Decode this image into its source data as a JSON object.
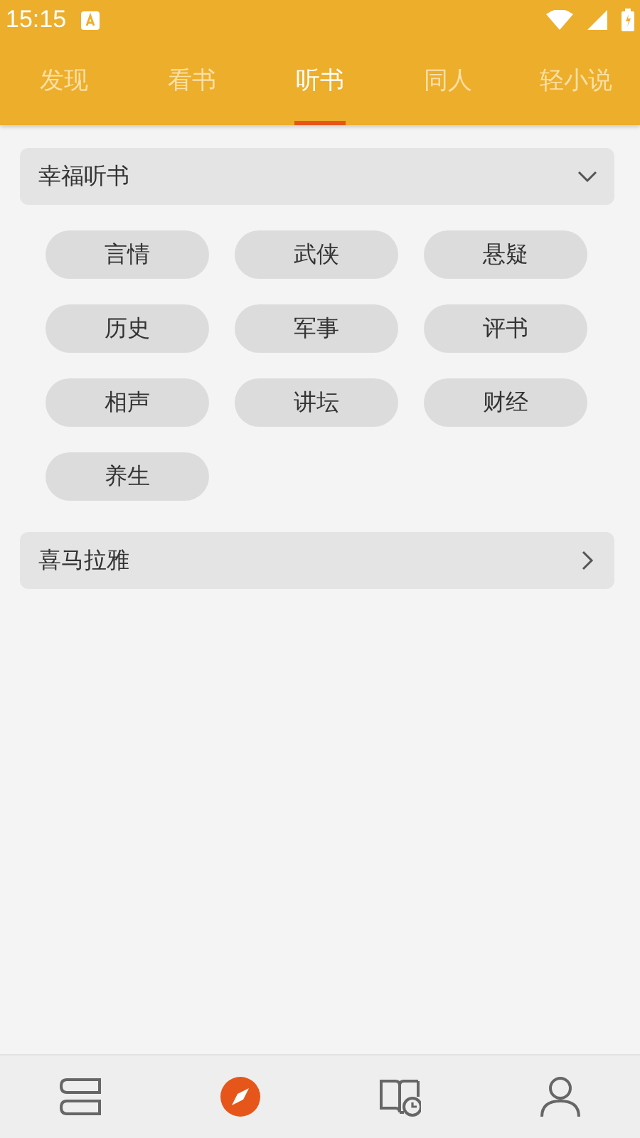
{
  "status_bar": {
    "time": "15:15"
  },
  "tabs": [
    {
      "label": "发现",
      "selected": false
    },
    {
      "label": "看书",
      "selected": false
    },
    {
      "label": "听书",
      "selected": true
    },
    {
      "label": "同人",
      "selected": false
    },
    {
      "label": "轻小说",
      "selected": false
    }
  ],
  "sections": [
    {
      "title": "幸福听书",
      "expanded": true,
      "tags": [
        "言情",
        "武侠",
        "悬疑",
        "历史",
        "军事",
        "评书",
        "相声",
        "讲坛",
        "财经",
        "养生"
      ]
    },
    {
      "title": "喜马拉雅",
      "expanded": false
    }
  ],
  "bottom_nav": [
    {
      "kind": "bookshelf",
      "selected": false
    },
    {
      "kind": "discover",
      "selected": true
    },
    {
      "kind": "history",
      "selected": false
    },
    {
      "kind": "profile",
      "selected": false
    }
  ]
}
